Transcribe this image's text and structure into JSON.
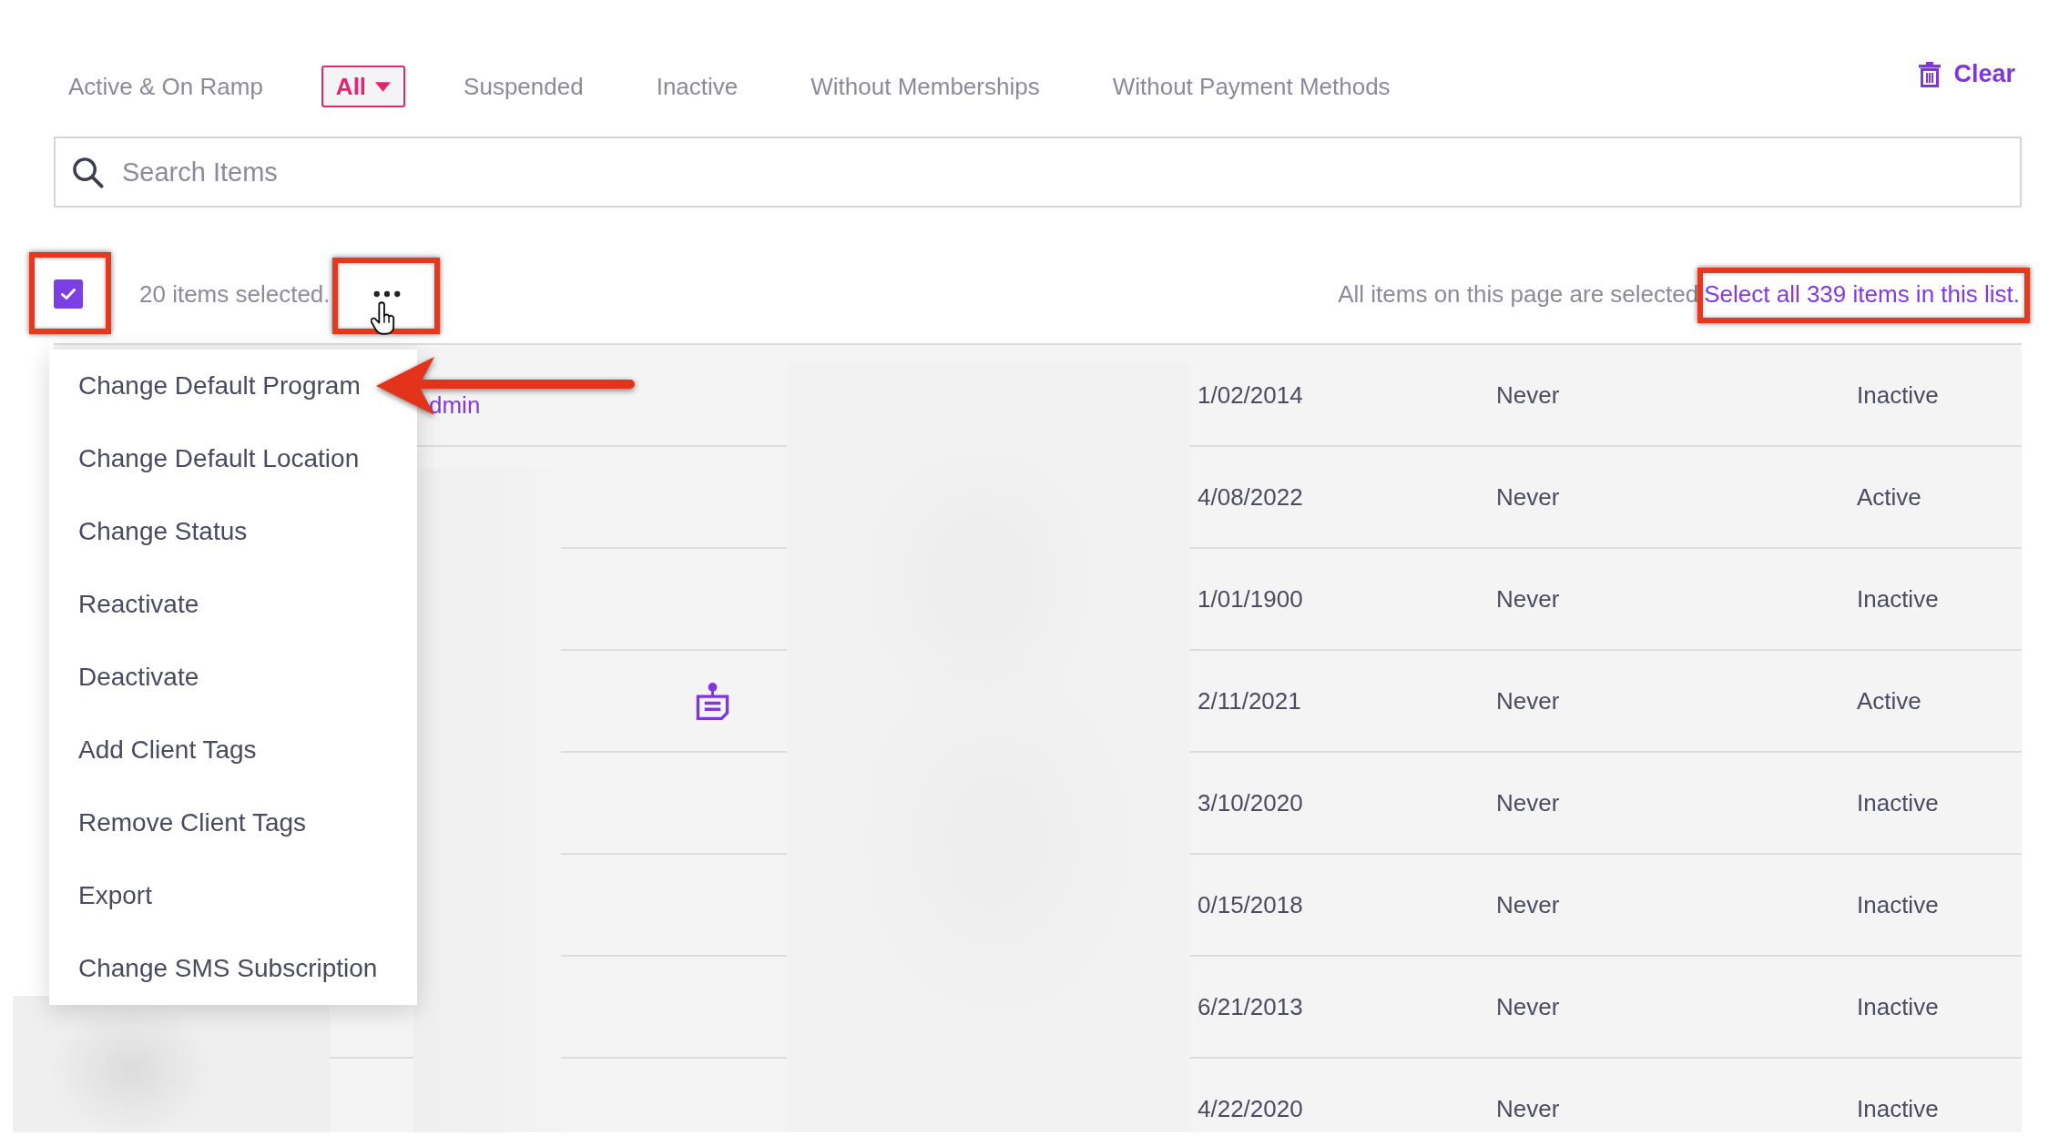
{
  "filter_tabs": [
    {
      "label": "Active & On Ramp",
      "selected": false,
      "kind": "plain"
    },
    {
      "label": "All",
      "selected": true,
      "kind": "dropdown"
    },
    {
      "label": "Suspended",
      "selected": false,
      "kind": "plain"
    },
    {
      "label": "Inactive",
      "selected": false,
      "kind": "plain"
    },
    {
      "label": "Without Memberships",
      "selected": false,
      "kind": "plain"
    },
    {
      "label": "Without Payment Methods",
      "selected": false,
      "kind": "plain"
    }
  ],
  "clear_button": {
    "label": "Clear"
  },
  "search": {
    "placeholder": "Search Items"
  },
  "selection_bar": {
    "all_checked": true,
    "checkbox_highlighted": true,
    "count": "20 items selected.",
    "more_button_highlighted": true,
    "more_button_hovered": true,
    "page_notice": "All items on this page are selected",
    "select_all_link": "Select all 339 items in this list.",
    "select_all_highlighted": true
  },
  "actions_menu": {
    "items": [
      {
        "label": "Change Default Program"
      },
      {
        "label": "Change Default Location"
      },
      {
        "label": "Change Status"
      },
      {
        "label": "Reactivate"
      },
      {
        "label": "Deactivate"
      },
      {
        "label": "Add Client Tags"
      },
      {
        "label": "Remove Client Tags"
      },
      {
        "label": "Export"
      },
      {
        "label": "Change SMS Subscription"
      }
    ]
  },
  "table": {
    "rows": [
      {
        "column_1": "dmin",
        "has_icon": false,
        "column_3": "1/02/2014",
        "column_4": "Never",
        "column_5": "Inactive"
      },
      {
        "has_icon": false,
        "column_3": "4/08/2022",
        "column_4": "Never",
        "column_5": "Active"
      },
      {
        "has_icon": false,
        "column_3": "1/01/1900",
        "column_4": "Never",
        "column_5": "Inactive"
      },
      {
        "has_icon": true,
        "column_3": "2/11/2021",
        "column_4": "Never",
        "column_5": "Active"
      },
      {
        "has_icon": false,
        "column_3": "3/10/2020",
        "column_4": "Never",
        "column_5": "Inactive"
      },
      {
        "has_icon": false,
        "column_3": "0/15/2018",
        "column_4": "Never",
        "column_5": "Inactive"
      },
      {
        "has_icon": false,
        "column_3": "6/21/2013",
        "column_4": "Never",
        "column_5": "Inactive"
      },
      {
        "has_icon": false,
        "column_3": "4/22/2020",
        "column_4": "Never",
        "column_5": "Inactive"
      }
    ]
  }
}
